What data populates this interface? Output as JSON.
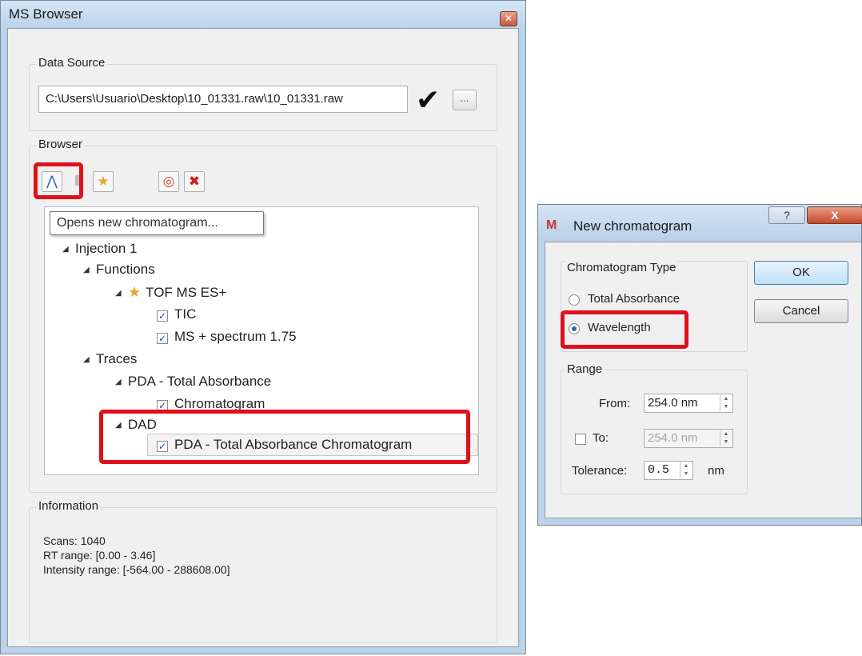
{
  "ms_browser": {
    "title": "MS Browser",
    "close_icon": "✕",
    "data_source": {
      "label": "Data Source",
      "path": "C:\\Users\\Usuario\\Desktop\\10_01331.raw\\10_01331.raw",
      "check_glyph": "✔",
      "browse_label": "..."
    },
    "browser": {
      "label": "Browser",
      "toolbar": [
        {
          "icon": "new-chromatogram-icon",
          "glyph": "⋀"
        },
        {
          "icon": "new-spectrum-icon",
          "glyph": "⦀"
        },
        {
          "icon": "favorite-icon",
          "glyph": "★"
        },
        {
          "icon": "target-icon",
          "glyph": "◎"
        },
        {
          "icon": "delete-icon",
          "glyph": "✖"
        }
      ],
      "tooltip": "Opens new chromatogram...",
      "tree": {
        "injection": "Injection 1",
        "functions": "Functions",
        "tof": "TOF MS ES+",
        "tic": "TIC",
        "ms_spectrum": "MS + spectrum 1.75",
        "traces": "Traces",
        "pda_total": "PDA - Total Absorbance",
        "chromatogram": "Chromatogram",
        "dad": "DAD",
        "pda_chrom": "PDA - Total Absorbance Chromatogram"
      }
    },
    "information": {
      "label": "Information",
      "scans": "Scans: 1040",
      "rt_range": "RT range: [0.00 - 3.46]",
      "intensity_range": "Intensity range: [-564.00 - 288608.00]"
    }
  },
  "new_chromatogram": {
    "title": "New chromatogram",
    "help_glyph": "?",
    "close_glyph": "X",
    "type_group": "Chromatogram Type",
    "total_absorbance": "Total Absorbance",
    "wavelength": "Wavelength",
    "ok": "OK",
    "cancel": "Cancel",
    "range_group": "Range",
    "from_label": "From:",
    "from_value": "254.0 nm",
    "to_label": "To:",
    "to_value": "254.0 nm",
    "tolerance_label": "Tolerance:",
    "tolerance_value": "0.5",
    "tolerance_unit": "nm"
  },
  "colors": {
    "highlight": "#e0101a",
    "title_bar": "#bcd3ea"
  }
}
